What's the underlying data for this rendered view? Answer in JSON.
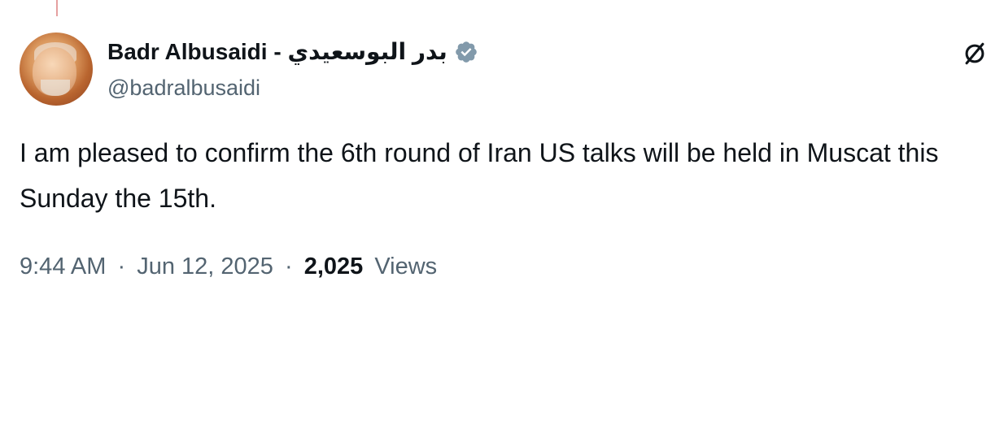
{
  "post": {
    "author": {
      "display_name": "Badr Albusaidi - بدر البوسعيدي",
      "handle": "@badralbusaidi",
      "verified": true,
      "avatar": "profile-photo"
    },
    "text": "I am pleased to confirm the 6th round of Iran US talks will be held in Muscat this Sunday the 15th.",
    "meta": {
      "time": "9:44 AM",
      "separator": "·",
      "date": "Jun 12, 2025",
      "views_count": "2,025",
      "views_label": "Views"
    },
    "action_icon": "grok-icon"
  },
  "colors": {
    "text_primary": "#0f1419",
    "text_secondary": "#536471",
    "verified_badge": "#829aab",
    "background": "#ffffff"
  }
}
